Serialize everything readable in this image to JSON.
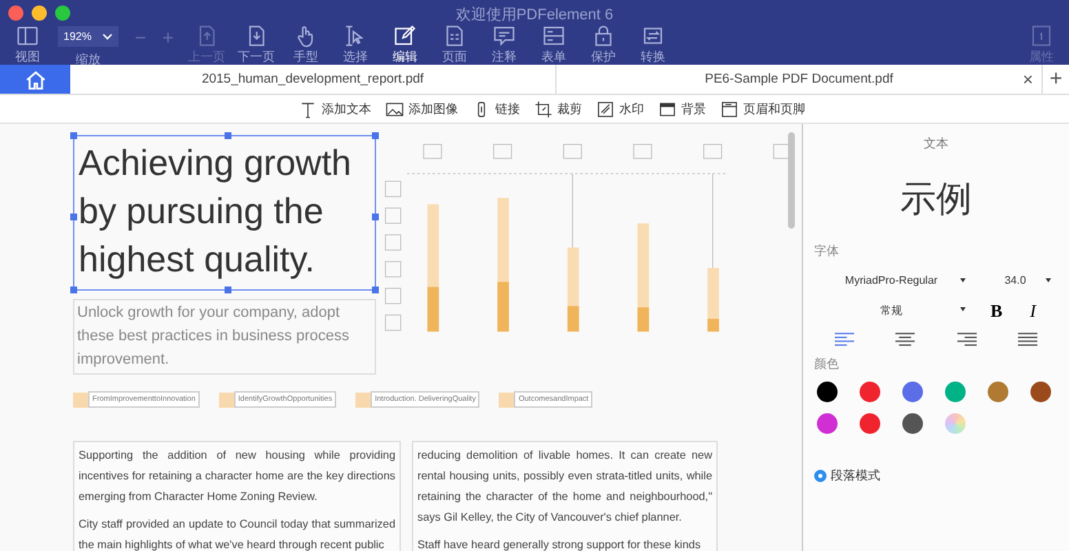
{
  "window": {
    "title": "欢迎使用PDFelement 6"
  },
  "toolbar": {
    "items": [
      {
        "kind": "view",
        "label": "视图",
        "disabled": false,
        "selected": false
      },
      {
        "kind": "zoom",
        "label": "缩放",
        "value": "192%",
        "disabled": false,
        "selected": false
      },
      {
        "kind": "minus",
        "label": "−",
        "disabled": true,
        "selected": false
      },
      {
        "kind": "plus",
        "label": "+",
        "disabled": true,
        "selected": false
      },
      {
        "kind": "prev",
        "label": "上一页",
        "disabled": true,
        "selected": false
      },
      {
        "kind": "next",
        "label": "下一页",
        "disabled": false,
        "selected": false
      },
      {
        "kind": "hand",
        "label": "手型",
        "disabled": false,
        "selected": false
      },
      {
        "kind": "select",
        "label": "选择",
        "disabled": false,
        "selected": false
      },
      {
        "kind": "edit",
        "label": "编辑",
        "disabled": false,
        "selected": true
      },
      {
        "kind": "pages",
        "label": "页面",
        "disabled": false,
        "selected": false
      },
      {
        "kind": "comment",
        "label": "注释",
        "disabled": false,
        "selected": false
      },
      {
        "kind": "form",
        "label": "表单",
        "disabled": false,
        "selected": false
      },
      {
        "kind": "protect",
        "label": "保护",
        "disabled": false,
        "selected": false
      },
      {
        "kind": "convert",
        "label": "转换",
        "disabled": false,
        "selected": false
      },
      {
        "kind": "properties",
        "label": "属性",
        "disabled": true,
        "selected": false
      }
    ]
  },
  "tabs": [
    {
      "kind": "home",
      "selected": true
    },
    {
      "kind": "document",
      "label": "2015_human_development_report.pdf",
      "selected": false
    },
    {
      "kind": "document",
      "label": "PE6-Sample PDF Document.pdf",
      "selected": false,
      "close": "×"
    }
  ],
  "new_tab": "+",
  "edit_toolbar": [
    {
      "kind": "text",
      "label": "添加文本"
    },
    {
      "kind": "image",
      "label": "添加图像"
    },
    {
      "kind": "link",
      "label": "链接"
    },
    {
      "kind": "crop",
      "label": "裁剪"
    },
    {
      "kind": "watermark",
      "label": "水印"
    },
    {
      "kind": "background",
      "label": "背景"
    },
    {
      "kind": "header",
      "label": "页眉和页脚"
    }
  ],
  "document": {
    "heading": "Achieving growth by pursuing the highest quality.",
    "subheading": "Unlock growth for your company, adopt these best practices in business process improvement.",
    "tags": [
      {
        "label": "FromImprovementtoInnovation"
      },
      {
        "label": "IdentifyGrowthOpportunities"
      },
      {
        "label": "Introduction. DeliveringQuality"
      },
      {
        "label": "OutcomesandImpact"
      }
    ],
    "columns": [
      {
        "paragraphs": [
          "Supporting the addition of new housing while providing incentives for retaining a character home are the key directions emerging from Character Home Zoning Review.",
          "City staff provided an update to Council today that summarized the main highlights of what we've heard through recent public"
        ]
      },
      {
        "paragraphs": [
          "reducing demolition of livable homes.  It can create new rental housing units, possibly even strata-titled units, while retaining the character of the home and neighbourhood,\" says Gil Kelley, the City of Vancouver's chief planner.",
          "Staff have heard generally strong support for these kinds"
        ]
      }
    ]
  },
  "panel": {
    "title": "文本",
    "sample": "示例",
    "font_label": "字体",
    "font": "MyriadPro-Regular",
    "size": "34.0",
    "style": "常规",
    "bold": "B",
    "italic": "I",
    "alignments": [
      {
        "kind": "left",
        "selected": true
      },
      {
        "kind": "center",
        "selected": false
      },
      {
        "kind": "right",
        "selected": false
      },
      {
        "kind": "justify",
        "selected": false
      }
    ],
    "color_label": "颜色",
    "swatches": [
      {
        "kind": "solid",
        "color": "#000000"
      },
      {
        "kind": "solid",
        "color": "#f0242e"
      },
      {
        "kind": "solid",
        "color": "#5b6ee8"
      },
      {
        "kind": "solid",
        "color": "#00b386"
      },
      {
        "kind": "solid",
        "color": "#b07a32"
      },
      {
        "kind": "solid",
        "color": "#9b4a1c"
      },
      {
        "kind": "solid",
        "color": "#cf2fd3"
      },
      {
        "kind": "solid",
        "color": "#f0242e"
      },
      {
        "kind": "solid",
        "color": "#555555"
      },
      {
        "kind": "spectrum"
      }
    ],
    "paragraph_mode": {
      "label": "段落模式",
      "checked": true
    }
  }
}
